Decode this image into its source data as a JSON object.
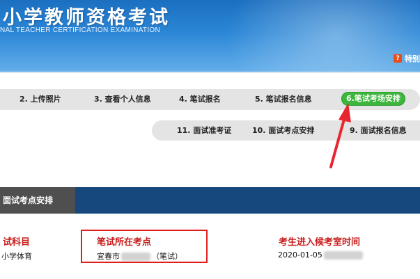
{
  "header": {
    "title": "小学教师资格考试",
    "subtitle": "NAL TEACHER CERTIFICATION EXAMINATION",
    "help_icon_glyph": "?",
    "right_link": "特别"
  },
  "steps_row1": [
    {
      "label": "2. 上传照片",
      "active": false
    },
    {
      "label": "3. 查看个人信息",
      "active": false
    },
    {
      "label": "4. 笔试报名",
      "active": false
    },
    {
      "label": "5. 笔试报名信息",
      "active": false
    },
    {
      "label": "6.笔试考场安排",
      "active": true
    }
  ],
  "steps_row2": [
    {
      "label": "11. 面试准考证"
    },
    {
      "label": "10. 面试考点安排"
    },
    {
      "label": "9. 面试报名信息"
    }
  ],
  "section": {
    "tab_label": "面试考点安排"
  },
  "columns": {
    "subject_head": "试科目",
    "subject_value": "小学体育",
    "venue_head": "笔试所在考点",
    "venue_value_prefix": "宜春市",
    "venue_value_suffix": "（笔试）",
    "time_head": "考生进入候考室时间",
    "time_value": "2020-01-05"
  },
  "colors": {
    "header_blue": "#1b6fc0",
    "active_green": "#3cb63c",
    "section_navy": "#16487e",
    "heading_red": "#c81d1d",
    "annotation_red": "#e02020"
  },
  "icons": {
    "help": "help-icon",
    "annotation": "red-arrow-icon"
  }
}
